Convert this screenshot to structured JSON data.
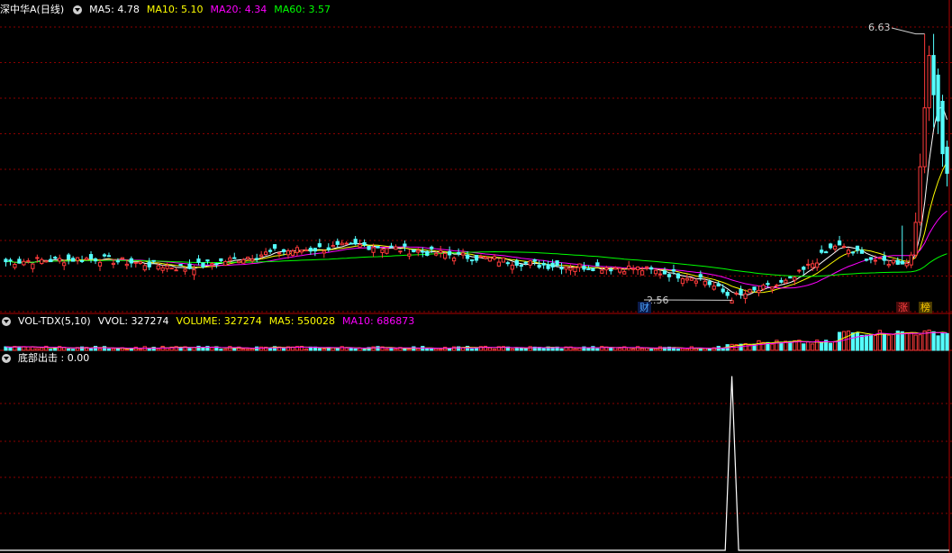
{
  "price_panel": {
    "title": "深中华A(日线)",
    "indicators": [
      {
        "label": "MA5: 4.78",
        "color": "#ffffff"
      },
      {
        "label": "MA10: 5.10",
        "color": "#ffff00"
      },
      {
        "label": "MA20: 4.34",
        "color": "#ff00ff"
      },
      {
        "label": "MA60: 3.57",
        "color": "#00ff00"
      }
    ],
    "high_label": "6.63",
    "low_label": "2.56",
    "badges": {
      "cai": "财",
      "zhang": "涨",
      "bang": "榜"
    }
  },
  "volume_panel": {
    "indicators": [
      {
        "label": "VOL-TDX(5,10)",
        "color": "#ffffff"
      },
      {
        "label": "VVOL: 327274",
        "color": "#ffffff"
      },
      {
        "label": "VOLUME: 327274",
        "color": "#ffff00"
      },
      {
        "label": "MA5: 550028",
        "color": "#ffff00"
      },
      {
        "label": "MA10: 686873",
        "color": "#ff00ff"
      }
    ]
  },
  "signal_panel": {
    "indicators": [
      {
        "label": "底部出击 : 0.00",
        "color": "#ffffff"
      }
    ]
  },
  "colors": {
    "up": "#ff3b3b",
    "down": "#54ffff",
    "ma5": "#ffffff",
    "ma10": "#ffff00",
    "ma20": "#ff00ff",
    "ma60": "#00ff00",
    "grid": "#8b0000"
  },
  "chart_data": [
    {
      "type": "candlestick",
      "title": "深中华A(日线)",
      "ylim": [
        2.4,
        6.9
      ],
      "price_anchors": {
        "x": [
          0,
          20,
          40,
          60,
          80,
          100,
          120,
          140,
          155,
          162,
          175,
          185,
          195,
          200,
          205,
          210
        ],
        "close": [
          3.15,
          3.2,
          3.05,
          3.3,
          3.4,
          3.25,
          3.1,
          3.05,
          2.9,
          2.6,
          2.85,
          3.4,
          3.15,
          3.15,
          3.0,
          6.2
        ]
      },
      "last_bars": {
        "open": [
          3.1,
          3.25,
          3.75,
          4.6,
          5.5,
          6.3,
          6.0,
          5.6,
          4.9
        ],
        "close": [
          3.25,
          3.75,
          4.6,
          5.5,
          6.3,
          5.7,
          5.3,
          4.8,
          4.5
        ],
        "high": [
          3.3,
          3.9,
          4.8,
          5.7,
          6.45,
          6.63,
          6.1,
          5.7,
          5.0
        ],
        "low": [
          3.05,
          3.2,
          3.7,
          4.5,
          5.3,
          5.2,
          5.1,
          4.6,
          4.3
        ]
      },
      "high": 6.63,
      "low": 2.56,
      "ma": {
        "MA5": 4.78,
        "MA10": 5.1,
        "MA20": 4.34,
        "MA60": 3.57
      }
    },
    {
      "type": "bar",
      "title": "VOL-TDX(5,10)",
      "vvol": 327274,
      "volume": 327274,
      "ma5": 550028,
      "ma10": 686873
    },
    {
      "type": "line",
      "title": "底部出击",
      "value": 0.0,
      "spike_bar": 162,
      "spike_value": 1.0,
      "ylim": [
        0,
        1.05
      ]
    }
  ]
}
